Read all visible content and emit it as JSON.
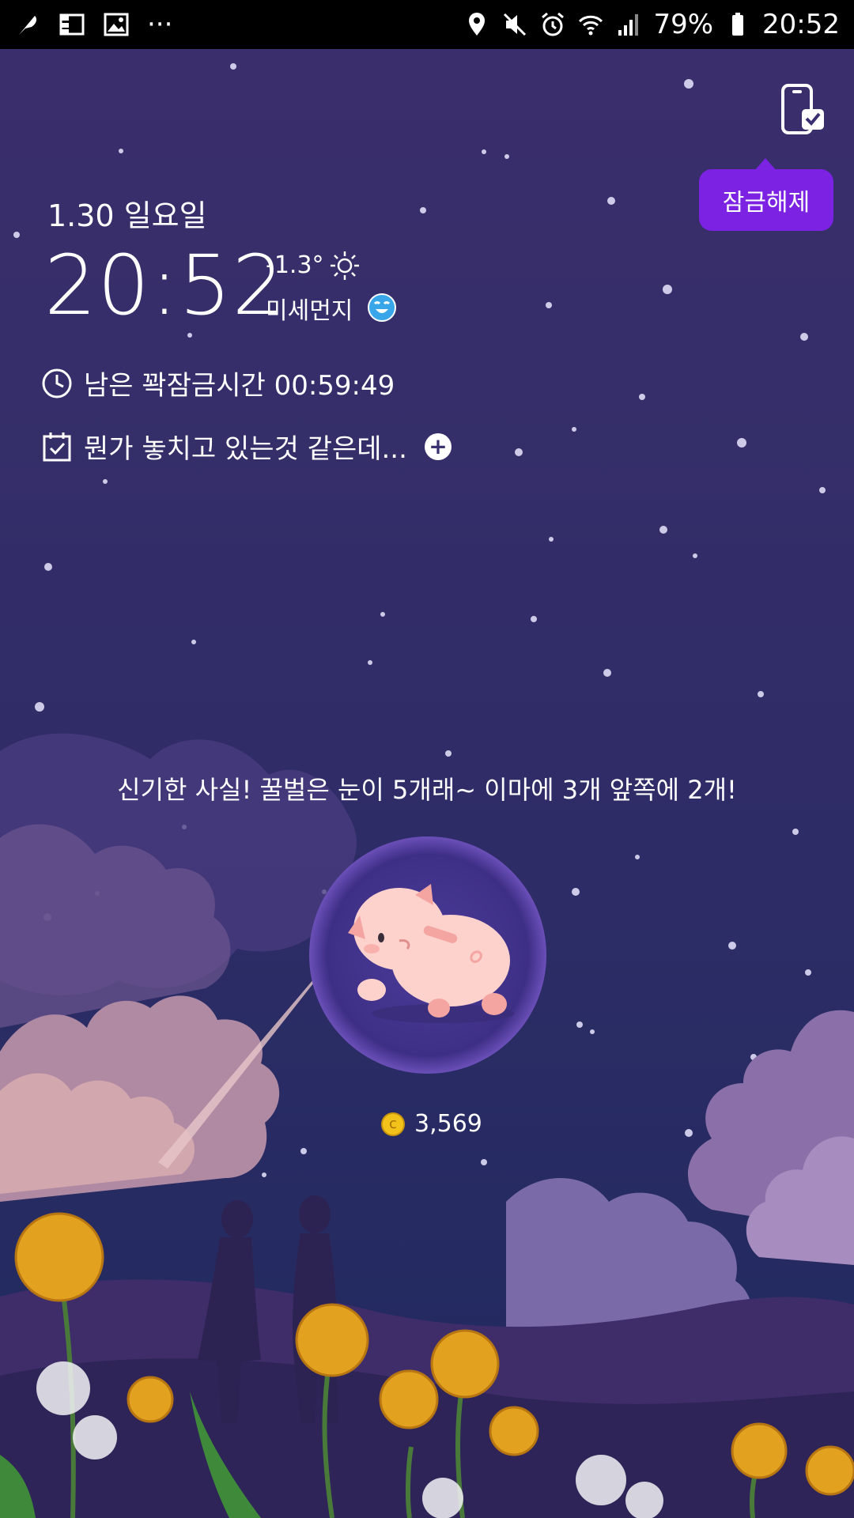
{
  "status_bar": {
    "left_icons": [
      "feather-icon",
      "grid-icon",
      "image-icon",
      "more-icon"
    ],
    "right_icons": [
      "location-icon",
      "mute-icon",
      "alarm-icon",
      "wifi-icon",
      "signal-icon",
      "battery-icon"
    ],
    "battery": "79%",
    "time": "20:52"
  },
  "lock": {
    "unlock_label": "잠금해제"
  },
  "clock": {
    "date": "1.30 일요일",
    "time": "20:52",
    "temperature": "-1.3°",
    "dust_label": "미세먼지"
  },
  "info_rows": {
    "remaining_label": "남은 꽉잠금시간 00:59:49",
    "todo_label": "뭔가 놓치고 있는것 같은데..."
  },
  "fact_text": "신기한 사실! 꿀벌은 눈이 5개래~ 이마에 3개 앞쪽에 2개!",
  "coins": "3,569",
  "colors": {
    "accent": "#7b22e3",
    "sky_top": "#3b2f6c",
    "sky_bottom": "#2a2f6a",
    "coin": "#f3c21a"
  }
}
